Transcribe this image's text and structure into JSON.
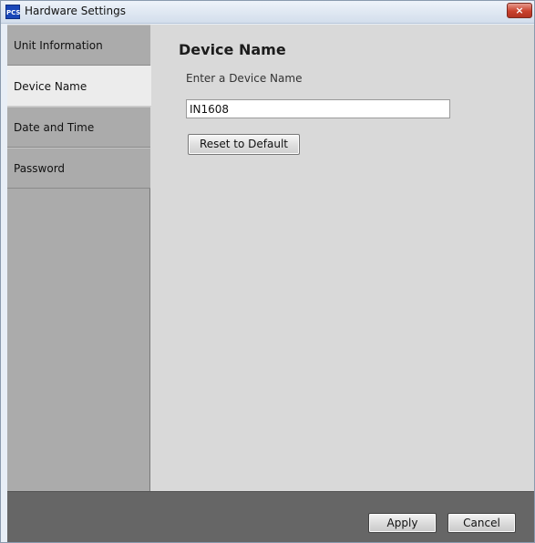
{
  "window": {
    "title": "Hardware Settings",
    "icon_label": "PCS",
    "close_glyph": "×"
  },
  "sidebar": {
    "items": [
      {
        "label": "Unit Information",
        "active": false
      },
      {
        "label": "Device Name",
        "active": true
      },
      {
        "label": "Date and Time",
        "active": false
      },
      {
        "label": "Password",
        "active": false
      }
    ]
  },
  "main": {
    "section_title": "Device Name",
    "field_label": "Enter a Device Name",
    "device_name_value": "IN1608",
    "reset_label": "Reset to Default"
  },
  "footer": {
    "apply_label": "Apply",
    "cancel_label": "Cancel"
  },
  "colors": {
    "sidebar_bg": "#ababab",
    "active_tab_bg": "#ececec",
    "content_bg": "#d9d9d9",
    "footer_bg": "#666666",
    "close_button": "#c9402c"
  }
}
